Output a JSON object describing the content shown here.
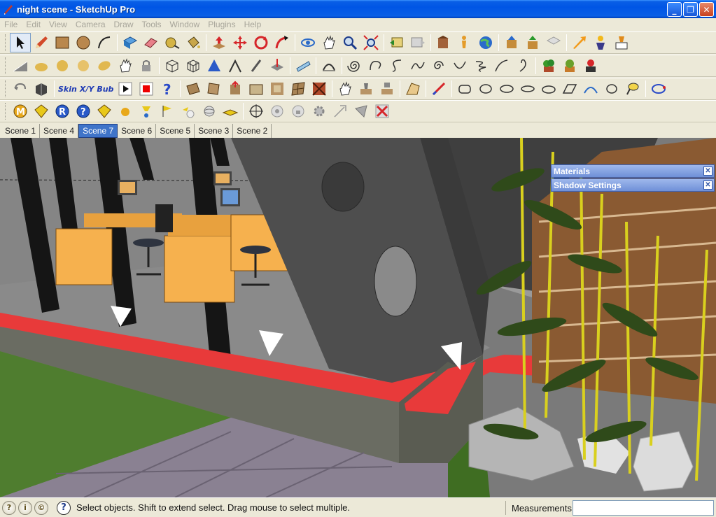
{
  "window": {
    "title": "night scene - SketchUp Pro"
  },
  "menu": [
    "File",
    "Edit",
    "View",
    "Camera",
    "Draw",
    "Tools",
    "Window",
    "Plugins",
    "Help"
  ],
  "toolbar_text": {
    "skin": "Skin",
    "xyz": "X/Y",
    "bub": "Bub"
  },
  "scenes": [
    {
      "label": "Scene 1",
      "active": false
    },
    {
      "label": "Scene 4",
      "active": false
    },
    {
      "label": "Scene 7",
      "active": true
    },
    {
      "label": "Scene 6",
      "active": false
    },
    {
      "label": "Scene 5",
      "active": false
    },
    {
      "label": "Scene 3",
      "active": false
    },
    {
      "label": "Scene 2",
      "active": false
    }
  ],
  "panels": {
    "materials": "Materials",
    "shadow": "Shadow Settings"
  },
  "status": {
    "hint": "Select objects. Shift to extend select. Drag mouse to select multiple.",
    "measurements_label": "Measurements",
    "measurements_value": ""
  },
  "colors": {
    "accent": "#0055e5",
    "red_stripe": "#e83a3a",
    "desk": "#f6b14e",
    "grass": "#4f7d2f",
    "bamboo": "#d9d01e"
  }
}
